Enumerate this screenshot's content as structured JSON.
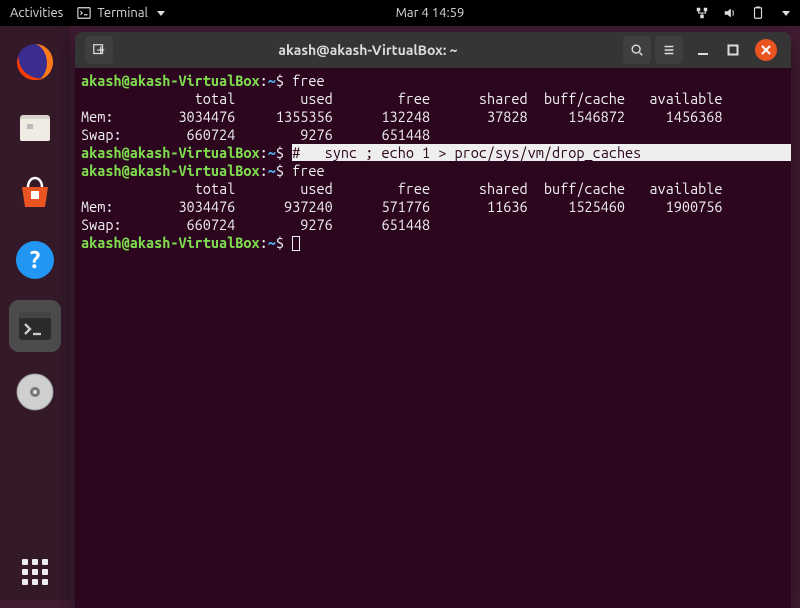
{
  "top_panel": {
    "activities": "Activities",
    "terminal_menu": "Terminal",
    "clock": "Mar 4  14:59"
  },
  "dock": {
    "items": [
      "firefox",
      "files",
      "software",
      "help",
      "terminal",
      "disc"
    ]
  },
  "window": {
    "title": "akash@akash-VirtualBox: ~"
  },
  "terminal": {
    "prompt_user": "akash@akash-VirtualBox",
    "prompt_sep": ":",
    "prompt_path": "~",
    "prompt_sigil": "$",
    "cmd_free": "free",
    "header": "              total        used        free      shared  buff/cache   available",
    "before": {
      "mem": "Mem:        3034476     1355356      132248       37828     1546872     1456368",
      "swap": "Swap:        660724        9276      651448"
    },
    "cmd_drop_hl": "#   sync ; echo 1 > proc/sys/vm/drop_caches                                 ",
    "after": {
      "mem": "Mem:        3034476      937240      571776       11636     1525460     1900756",
      "swap": "Swap:        660724        9276      651448"
    }
  }
}
